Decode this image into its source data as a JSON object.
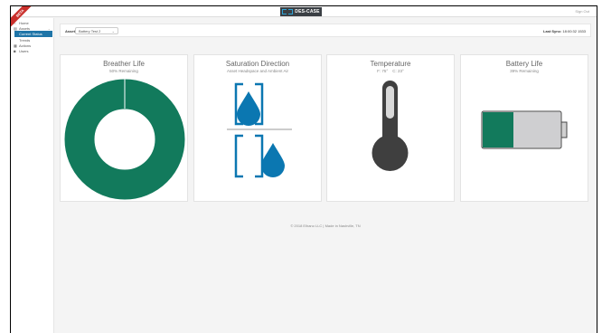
{
  "ribbon": {
    "label": "BETA"
  },
  "header": {
    "logo_text": "DES-CASE",
    "signout_label": "Sign Out"
  },
  "sidebar": {
    "items": [
      {
        "label": "Home",
        "icon": "home-icon"
      },
      {
        "label": "Assets",
        "icon": "assets-icon",
        "children": [
          {
            "label": "Current Status",
            "active": true
          },
          {
            "label": "Trends",
            "active": false
          }
        ]
      },
      {
        "label": "Actions",
        "icon": "actions-icon"
      },
      {
        "label": "Users",
        "icon": "users-icon"
      }
    ]
  },
  "asset_bar": {
    "label": "Asset",
    "selected": "Battery Test 2",
    "last_sync_label": "Last Sync:",
    "last_sync_value": "18:00:32 1533"
  },
  "cards": {
    "breather": {
      "title": "Breather Life",
      "subtitle": "50% Remaining",
      "remaining_fraction": 0.5,
      "color": "#127a5c"
    },
    "saturation": {
      "title": "Saturation Direction",
      "subtitle": "Asset Headspace and Ambient Air",
      "color": "#0b77b1"
    },
    "temperature": {
      "title": "Temperature",
      "subtitle_f": "F: 75°",
      "subtitle_c": "C: 23°",
      "color": "#3f3f3f"
    },
    "battery": {
      "title": "Battery Life",
      "subtitle": "39% Remaining",
      "level_fraction": 0.39,
      "color": "#127a5c"
    }
  },
  "footer": {
    "text": "© 2018 Elhano LLC | Made in Nashville, TN"
  }
}
